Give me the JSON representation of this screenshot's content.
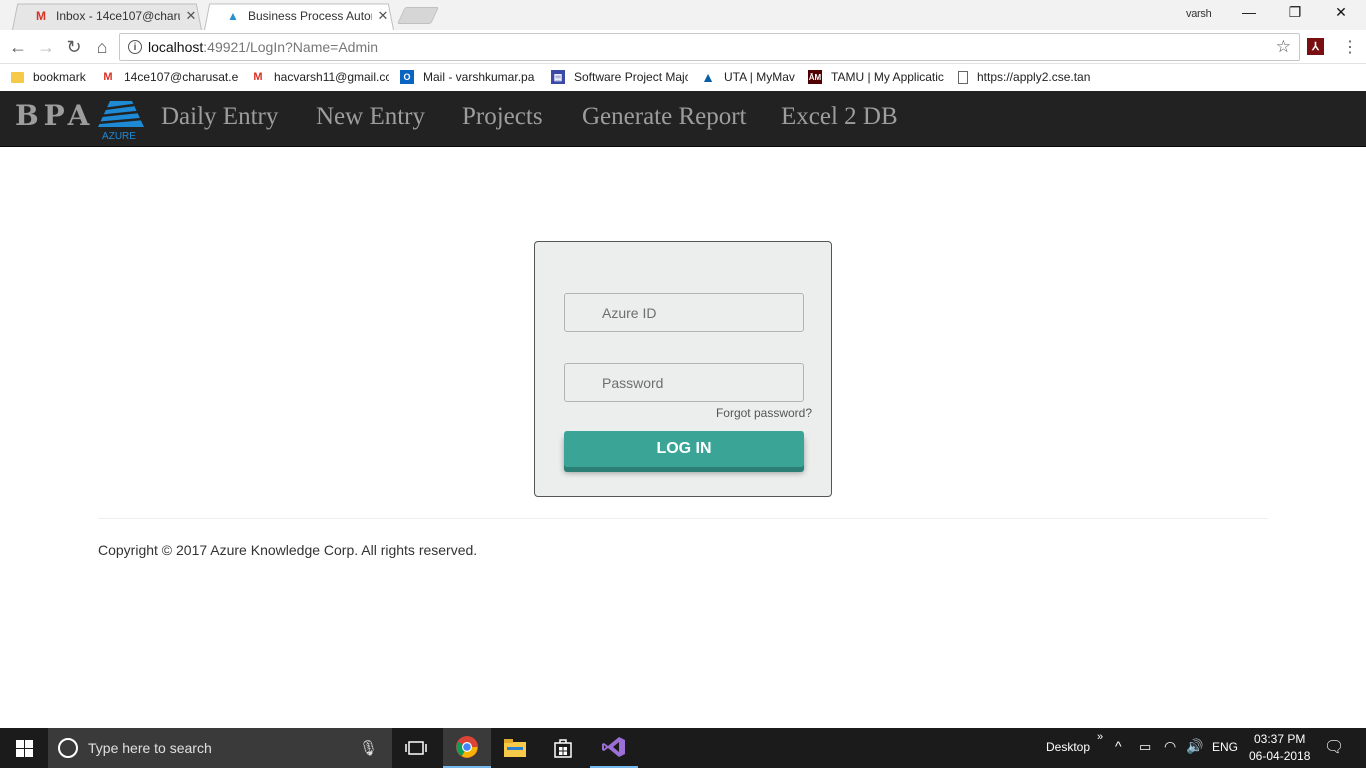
{
  "browser": {
    "tabs": [
      {
        "title": "Inbox - 14ce107@charus",
        "icon": "gmail-icon"
      },
      {
        "title": "Business Process Automa",
        "icon": "azure-icon",
        "active": true
      }
    ],
    "user": "varsh",
    "url_host": "localhost",
    "url_rest": ":49921/LogIn?Name=Admin",
    "bookmarks": [
      {
        "label": "bookmark",
        "icon": "folder-icon"
      },
      {
        "label": "14ce107@charusat.ec",
        "icon": "gmail-icon"
      },
      {
        "label": "hacvarsh11@gmail.cc",
        "icon": "gmail-icon"
      },
      {
        "label": "Mail - varshkumar.pa",
        "icon": "outlook-icon"
      },
      {
        "label": "Software Project Majc",
        "icon": "app-icon"
      },
      {
        "label": "UTA | MyMav",
        "icon": "uta-icon"
      },
      {
        "label": "TAMU | My Applicatic",
        "icon": "tamu-icon"
      },
      {
        "label": "https://apply2.cse.tan",
        "icon": "page-icon"
      }
    ]
  },
  "app": {
    "brand": "BPA",
    "logo_text": "AZURE",
    "nav": [
      "Daily Entry",
      "New Entry",
      "Projects",
      "Generate Report",
      "Excel 2 DB"
    ]
  },
  "login": {
    "id_placeholder": "Azure ID",
    "password_placeholder": "Password",
    "forgot": "Forgot password?",
    "button": "LOG IN"
  },
  "footer": {
    "copyright": "Copyright © 2017 Azure Knowledge Corp. All rights reserved."
  },
  "taskbar": {
    "search_placeholder": "Type here to search",
    "desktop": "Desktop",
    "lang": "ENG",
    "time": "03:37 PM",
    "date": "06-04-2018"
  },
  "colors": {
    "navbar": "#222222",
    "button": "#3aa597",
    "panel": "#eceeed"
  }
}
